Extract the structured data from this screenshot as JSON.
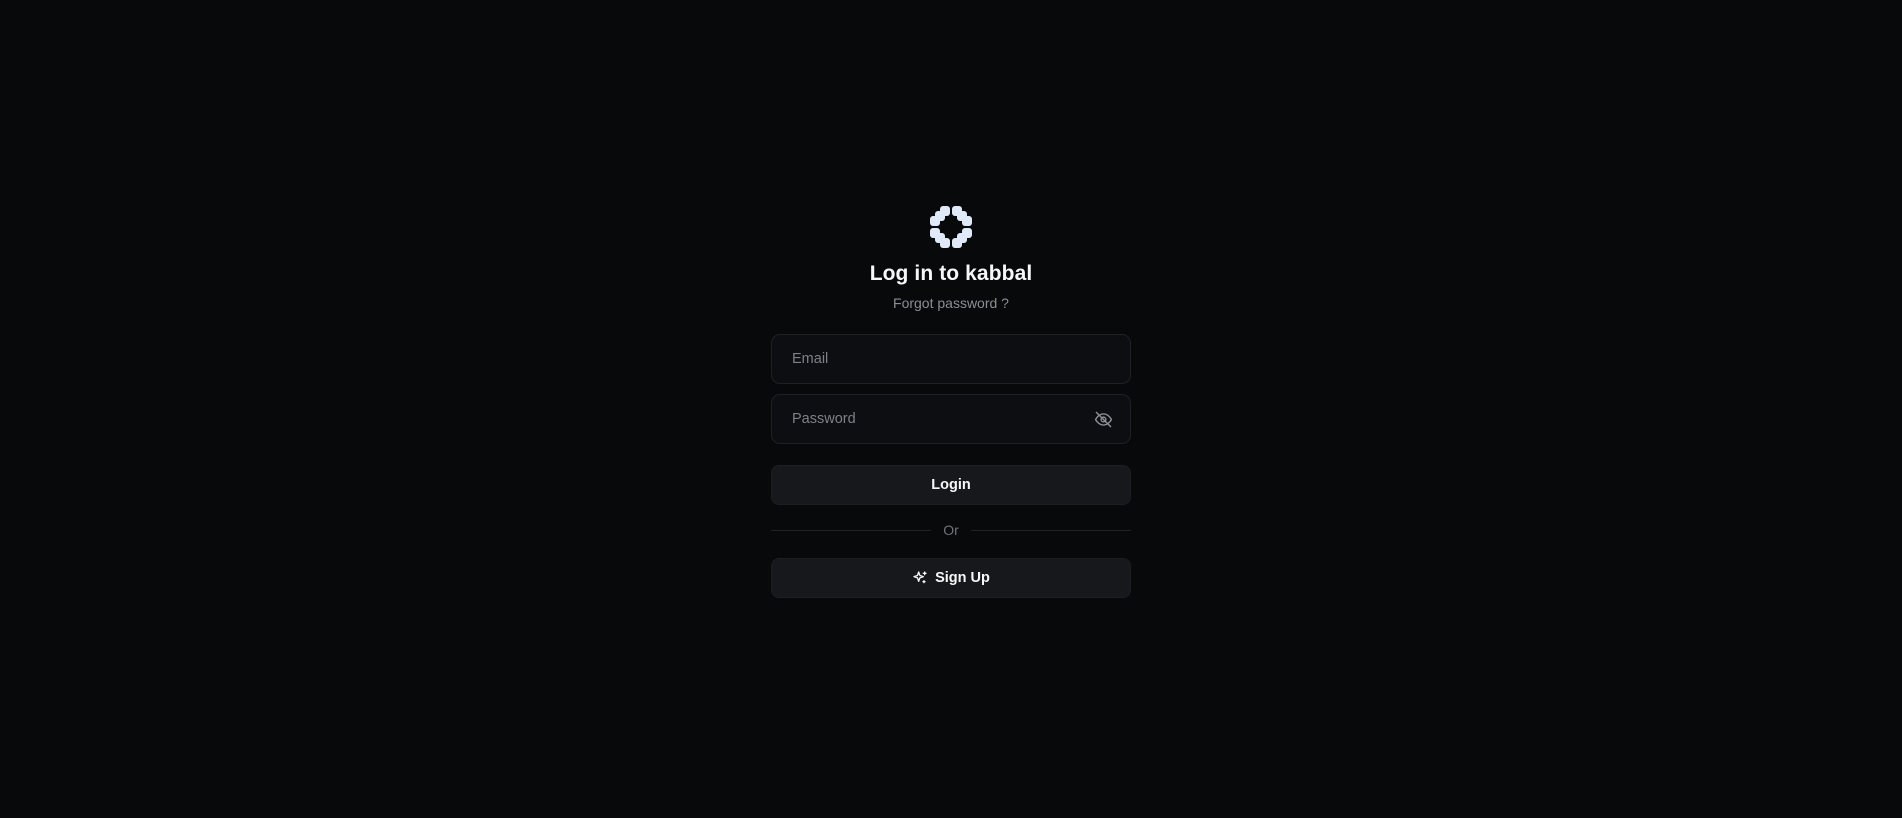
{
  "login": {
    "title": "Log in to kabbal",
    "forgot_password": "Forgot password ?",
    "email": {
      "placeholder": "Email",
      "value": ""
    },
    "password": {
      "placeholder": "Password",
      "value": ""
    },
    "login_label": "Login",
    "divider_label": "Or",
    "signup_label": "Sign Up"
  },
  "icons": {
    "logo": "kabbal-logo-icon",
    "password_toggle": "eye-off-icon",
    "signup": "sparkles-icon"
  },
  "colors": {
    "background": "#08090b",
    "logo": "#dfe9f7",
    "button_bg": "#17181b",
    "field_bg": "#0d0e11",
    "muted_text": "#8a8e95"
  }
}
